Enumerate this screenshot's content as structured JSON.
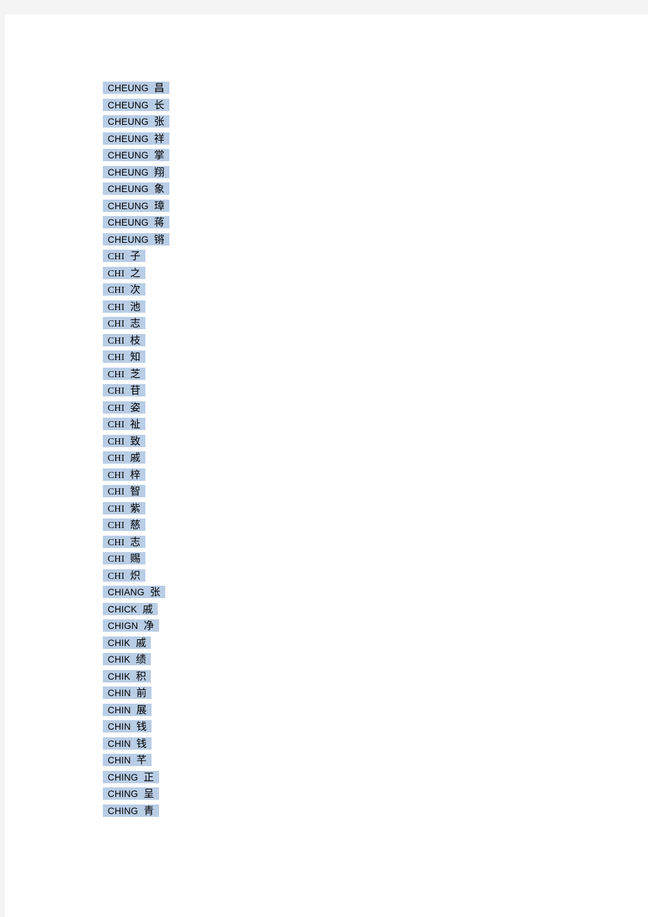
{
  "page": {
    "background_color": "#f4f4f4",
    "sheet_color": "#ffffff",
    "highlight_color": "#b9cde5",
    "text_color": "#000000"
  },
  "entries": [
    {
      "roman": "CHEUNG",
      "han": "昌",
      "style": "sans"
    },
    {
      "roman": "CHEUNG",
      "han": "长",
      "style": "sans"
    },
    {
      "roman": "CHEUNG",
      "han": "张",
      "style": "sans"
    },
    {
      "roman": "CHEUNG",
      "han": "祥",
      "style": "sans"
    },
    {
      "roman": "CHEUNG",
      "han": "掌",
      "style": "sans"
    },
    {
      "roman": "CHEUNG",
      "han": "翔",
      "style": "sans"
    },
    {
      "roman": "CHEUNG",
      "han": "象",
      "style": "sans"
    },
    {
      "roman": "CHEUNG",
      "han": "璋",
      "style": "sans"
    },
    {
      "roman": "CHEUNG",
      "han": "蒋",
      "style": "sans"
    },
    {
      "roman": "CHEUNG",
      "han": "锵",
      "style": "sans"
    },
    {
      "roman": "CHI",
      "han": "子",
      "style": "serif"
    },
    {
      "roman": "CHI",
      "han": "之",
      "style": "serif"
    },
    {
      "roman": "CHI",
      "han": "次",
      "style": "serif"
    },
    {
      "roman": "CHI",
      "han": "池",
      "style": "serif"
    },
    {
      "roman": "CHI",
      "han": "志",
      "style": "serif"
    },
    {
      "roman": "CHI",
      "han": "枝",
      "style": "serif"
    },
    {
      "roman": "CHI",
      "han": "知",
      "style": "serif"
    },
    {
      "roman": "CHI",
      "han": "芝",
      "style": "serif"
    },
    {
      "roman": "CHI",
      "han": "苷",
      "style": "serif"
    },
    {
      "roman": "CHI",
      "han": "姿",
      "style": "serif"
    },
    {
      "roman": "CHI",
      "han": "祉",
      "style": "serif"
    },
    {
      "roman": "CHI",
      "han": "致",
      "style": "serif"
    },
    {
      "roman": "CHI",
      "han": "戚",
      "style": "serif"
    },
    {
      "roman": "CHI",
      "han": "梓",
      "style": "serif"
    },
    {
      "roman": "CHI",
      "han": "智",
      "style": "serif"
    },
    {
      "roman": "CHI",
      "han": "紫",
      "style": "serif"
    },
    {
      "roman": "CHI",
      "han": "慈",
      "style": "serif"
    },
    {
      "roman": "CHI",
      "han": "志",
      "style": "serif"
    },
    {
      "roman": "CHI",
      "han": "赐",
      "style": "serif"
    },
    {
      "roman": "CHI",
      "han": "炽",
      "style": "serif"
    },
    {
      "roman": "CHIANG",
      "han": "张",
      "style": "sans"
    },
    {
      "roman": "CHICK",
      "han": "戚",
      "style": "sans"
    },
    {
      "roman": "CHIGN",
      "han": "净",
      "style": "sans"
    },
    {
      "roman": "CHIK",
      "han": "戚",
      "style": "sans"
    },
    {
      "roman": "CHIK",
      "han": "绩",
      "style": "sans"
    },
    {
      "roman": "CHIK",
      "han": "积",
      "style": "sans"
    },
    {
      "roman": "CHIN",
      "han": "前",
      "style": "sans"
    },
    {
      "roman": "CHIN",
      "han": "展",
      "style": "sans"
    },
    {
      "roman": "CHIN",
      "han": "钱",
      "style": "sans"
    },
    {
      "roman": "CHIN",
      "han": "钱",
      "style": "sans"
    },
    {
      "roman": "CHIN",
      "han": "芊",
      "style": "sans"
    },
    {
      "roman": "CHING",
      "han": "正",
      "style": "sans"
    },
    {
      "roman": "CHING",
      "han": "呈",
      "style": "sans"
    },
    {
      "roman": "CHING",
      "han": "青",
      "style": "sans"
    }
  ]
}
